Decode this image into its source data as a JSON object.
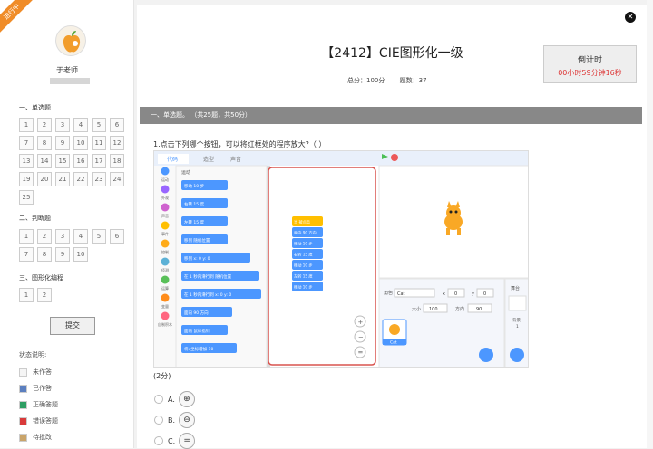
{
  "ribbon": "进行中",
  "teacher": {
    "name": "于老师"
  },
  "sections": [
    {
      "title": "一、单选题",
      "items": [
        "1",
        "2",
        "3",
        "4",
        "5",
        "6",
        "7",
        "8",
        "9",
        "10",
        "11",
        "12",
        "13",
        "14",
        "15",
        "16",
        "17",
        "18",
        "19",
        "20",
        "21",
        "22",
        "23",
        "24",
        "25"
      ]
    },
    {
      "title": "二、判断题",
      "items": [
        "1",
        "2",
        "3",
        "4",
        "5",
        "6",
        "7",
        "8",
        "9",
        "10"
      ]
    },
    {
      "title": "三、图形化编程",
      "items": [
        "1",
        "2"
      ]
    }
  ],
  "submit_label": "提交",
  "legend": {
    "title": "状态说明:",
    "items": [
      {
        "label": "未作答",
        "color": "#f5f5f5"
      },
      {
        "label": "已作答",
        "color": "#5b7fbf"
      },
      {
        "label": "正确答题",
        "color": "#2e9e63"
      },
      {
        "label": "错误答题",
        "color": "#d93a3a"
      },
      {
        "label": "待批改",
        "color": "#c9a46a"
      }
    ]
  },
  "exam": {
    "title": "【2412】CIE图形化一级",
    "total_score": "总分：100分",
    "question_count": "题数：37"
  },
  "timer": {
    "label": "倒计时",
    "value": "00小时59分钟16秒"
  },
  "section_bar": "一、单选题。 （共25题，共50分）",
  "question": {
    "text": "1.点击下列哪个按钮，可以将红框处的程序放大?（ ）",
    "points": "(2分)",
    "options": [
      {
        "letter": "A.",
        "icon": "zoom-in-icon",
        "glyph": "⊕"
      },
      {
        "letter": "B.",
        "icon": "zoom-out-icon",
        "glyph": "⊖"
      },
      {
        "letter": "C.",
        "icon": "reset-zoom-icon",
        "glyph": "="
      }
    ]
  },
  "scratch": {
    "tabs": [
      "代码",
      "造型",
      "声音"
    ],
    "categories": [
      "运动",
      "外观",
      "声音",
      "事件",
      "控制",
      "侦测",
      "运算",
      "变量",
      "自制积木"
    ],
    "category_colors": [
      "#4c97ff",
      "#9966ff",
      "#cf63cf",
      "#ffbf00",
      "#ffab19",
      "#5cb1d6",
      "#59c059",
      "#ff8c1a",
      "#ff6680"
    ],
    "palette_label": "运动",
    "palette_blocks": [
      "移动 10 步",
      "右转 15 度",
      "左转 15 度",
      "移到 随机位置",
      "移到 x: 0 y: 0",
      "在 1 秒内滑行到 随机位置",
      "在 1 秒内滑行到 x: 0 y: 0",
      "面向 90 方向",
      "面向 鼠标指针",
      "将x坐标增加 10"
    ],
    "script_blocks": [
      "当 被点击",
      "面向 90 方向",
      "移动 10 步",
      "右转 15 度",
      "移动 10 步",
      "左转 15 度",
      "移动 10 步"
    ],
    "sprite_label": "角色",
    "sprite_name": "Cat",
    "x_label": "x",
    "x_value": "0",
    "y_label": "y",
    "y_value": "0",
    "size_label": "大小",
    "size_value": "100",
    "direction_label": "方向",
    "direction_value": "90",
    "stage_label": "舞台",
    "backdrop_label": "背景",
    "backdrop_count": "1"
  }
}
